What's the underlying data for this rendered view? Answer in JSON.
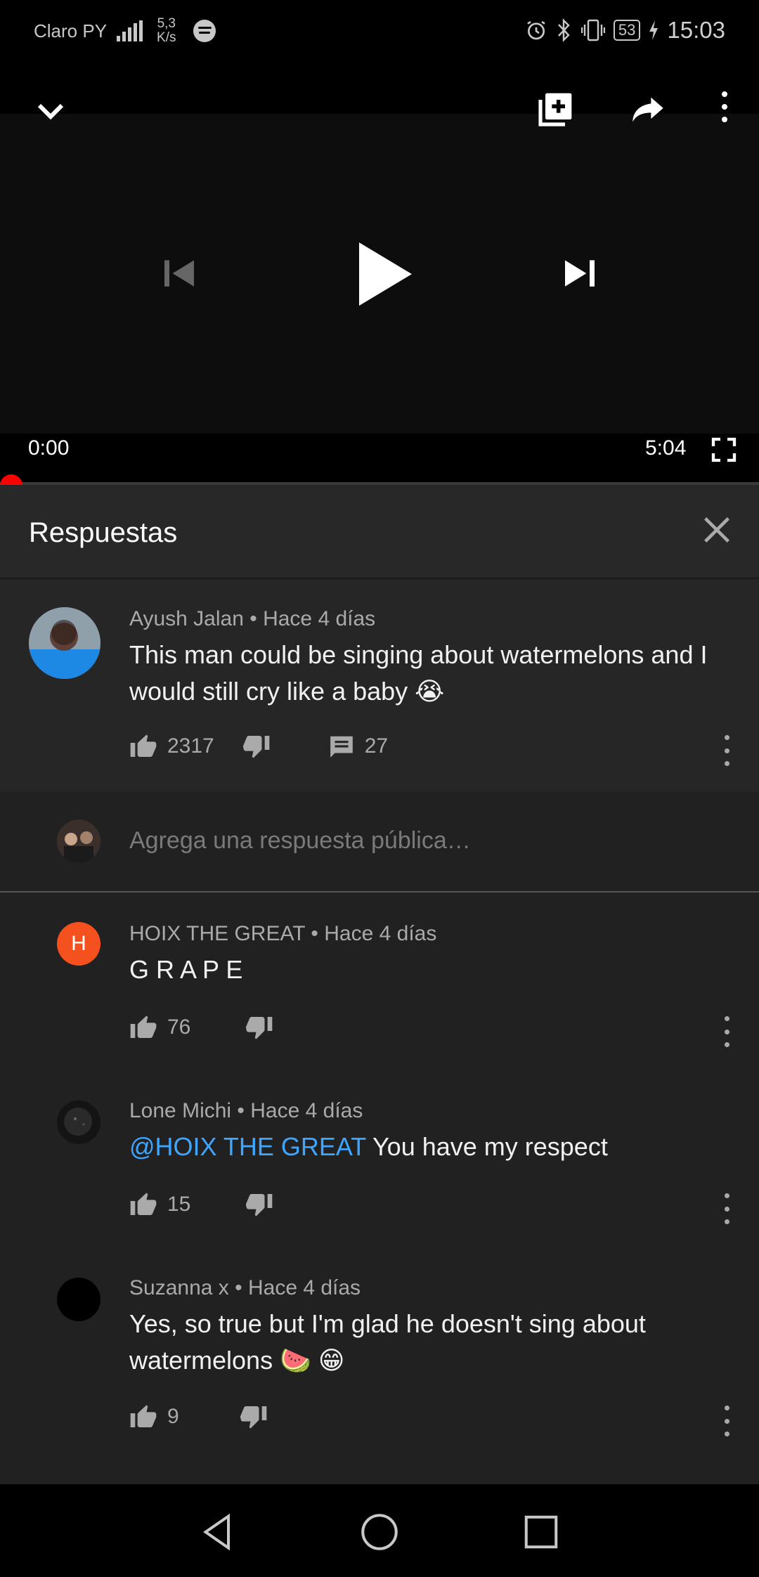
{
  "status_bar": {
    "carrier": "Claro PY",
    "speed_value": "5,3",
    "speed_unit": "K/s",
    "battery": "53",
    "time": "15:03"
  },
  "player": {
    "current_time": "0:00",
    "total_time": "5:04",
    "progress": 0,
    "icons": [
      "chevron-down-icon",
      "add-to-playlist-icon",
      "share-icon",
      "more-vert-icon",
      "skip-previous-icon",
      "play-icon",
      "skip-next-icon",
      "fullscreen-icon"
    ]
  },
  "panel": {
    "title": "Respuestas",
    "reply_placeholder": "Agrega una respuesta pública…"
  },
  "parent_comment": {
    "author": "Ayush Jalan",
    "time": "Hace 4 días",
    "text": "This man could be singing about watermelons and I would still cry like a baby 😭",
    "likes": "2317",
    "replies": "27"
  },
  "replies": [
    {
      "author": "HOIX THE GREAT",
      "time": "Hace 4 días",
      "avatar_letter": "H",
      "avatar_color": "#f4511e",
      "text": "G R A P E",
      "likes": "76"
    },
    {
      "author": "Lone Michi",
      "time": "Hace 4 días",
      "mention": "@HOIX THE GREAT",
      "text": " You have my respect",
      "likes": "15"
    },
    {
      "author": "Suzanna x",
      "time": "Hace 4 días",
      "text": "Yes, so true but I'm glad he doesn't sing about watermelons 🍉 😁",
      "likes": "9"
    }
  ],
  "colors": {
    "accent_red": "#ff0000",
    "mention_blue": "#3ea6ff",
    "panel_bg": "#212121"
  }
}
